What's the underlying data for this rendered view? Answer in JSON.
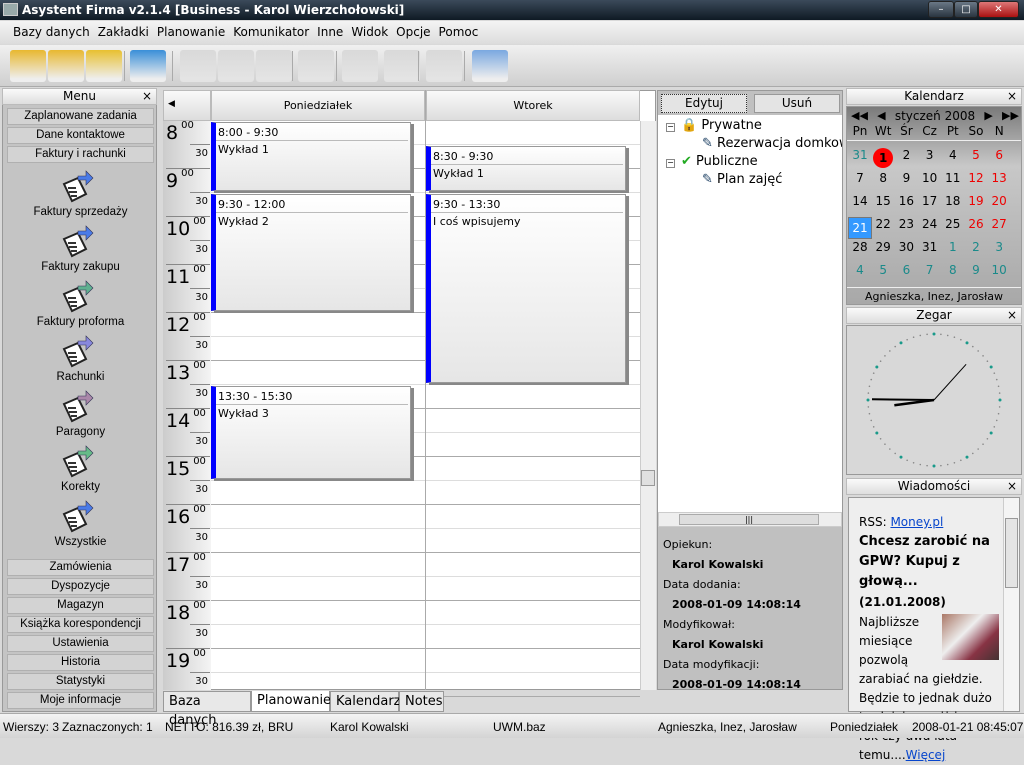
{
  "window": {
    "title": "Asystent Firma v2.1.4  [Business - Karol Wierzchołowski]",
    "minimize": "–",
    "maximize": "□",
    "close": "✕"
  },
  "menubar": [
    "Bazy danych",
    "Zakładki",
    "Planowanie",
    "Komunikator",
    "Inne",
    "Widok",
    "Opcje",
    "Pomoc"
  ],
  "toolbar": [
    "open-db-icon",
    "db-icon",
    "close-db-icon",
    "print-icon",
    "add-icon",
    "edit-icon",
    "remove-icon",
    "check-icon",
    "export-icon",
    "import-icon",
    "mail-icon",
    "calculator-icon"
  ],
  "sidebar": {
    "title": "Menu",
    "close": "×",
    "top_items": [
      "Zaplanowane zadania",
      "Dane kontaktowe",
      "Faktury i rachunki"
    ],
    "icons": [
      {
        "label": "Faktury sprzedaży",
        "color": "#4a7be8"
      },
      {
        "label": "Faktury zakupu",
        "color": "#4a7be8"
      },
      {
        "label": "Faktury proforma",
        "color": "#5fb090"
      },
      {
        "label": "Rachunki",
        "color": "#8888dd"
      },
      {
        "label": "Paragony",
        "color": "#aa88aa"
      },
      {
        "label": "Korekty",
        "color": "#66bb88"
      },
      {
        "label": "Wszystkie",
        "color": "#4a7be8"
      }
    ],
    "bottom_items": [
      "Zamówienia",
      "Dyspozycje",
      "Magazyn",
      "Książka korespondencji",
      "Ustawienia",
      "Historia",
      "Statystyki",
      "Moje informacje"
    ]
  },
  "planner": {
    "days": [
      "Poniedziałek",
      "Wtorek"
    ],
    "hours": [
      "8",
      "9",
      "10",
      "11",
      "12",
      "13",
      "14",
      "15",
      "16",
      "17",
      "18",
      "19"
    ],
    "min00": "00",
    "min30": "30",
    "events": [
      {
        "day": 0,
        "start": 8,
        "end": 9.5,
        "time": "8:00 - 9:30",
        "subject": "Wykład 1"
      },
      {
        "day": 0,
        "start": 9.5,
        "end": 12,
        "time": "9:30 - 12:00",
        "subject": "Wykład 2"
      },
      {
        "day": 0,
        "start": 13.5,
        "end": 15.5,
        "time": "13:30 - 15:30",
        "subject": "Wykład 3"
      },
      {
        "day": 1,
        "start": 8.5,
        "end": 9.5,
        "time": "8:30 - 9:30",
        "subject": "Wykład 1"
      },
      {
        "day": 1,
        "start": 9.5,
        "end": 13.5,
        "time": "9:30 - 13:30",
        "subject": "I coś wpisujemy"
      }
    ],
    "accent": "#0000ff"
  },
  "tabs": [
    {
      "label": "Baza danych",
      "active": false
    },
    {
      "label": "Planowanie",
      "active": true
    },
    {
      "label": "Kalendarz",
      "active": false
    },
    {
      "label": "Notes",
      "active": false
    }
  ],
  "tree": {
    "edit": "Edytuj",
    "delete": "Usuń",
    "groups": [
      {
        "label": "Prywatne",
        "icon": "lock-icon",
        "children": [
          "Rezerwacja domkow"
        ]
      },
      {
        "label": "Publiczne",
        "icon": "public-check-icon",
        "children": [
          "Plan zajęć"
        ]
      }
    ]
  },
  "details": {
    "owner_label": "Opiekun:",
    "owner": "Karol Kowalski",
    "added_label": "Data dodania:",
    "added": "2008-01-09 14:08:14",
    "modby_label": "Modyfikował:",
    "modby": "Karol Kowalski",
    "mod_label": "Data modyfikacji:",
    "mod": "2008-01-09 14:08:14"
  },
  "calendar": {
    "title": "Kalendarz",
    "close": "×",
    "month": "styczeń 2008",
    "weekdays": [
      "Pn",
      "Wt",
      "Śr",
      "Cz",
      "Pt",
      "So",
      "N"
    ],
    "weeks": [
      [
        "31",
        "1",
        "2",
        "3",
        "4",
        "5",
        "6"
      ],
      [
        "7",
        "8",
        "9",
        "10",
        "11",
        "12",
        "13"
      ],
      [
        "14",
        "15",
        "16",
        "17",
        "18",
        "19",
        "20"
      ],
      [
        "21",
        "22",
        "23",
        "24",
        "25",
        "26",
        "27"
      ],
      [
        "28",
        "29",
        "30",
        "31",
        "1",
        "2",
        "3"
      ],
      [
        "4",
        "5",
        "6",
        "7",
        "8",
        "9",
        "10"
      ]
    ],
    "today": "21",
    "holiday": "1",
    "namedays": "Agnieszka, Inez, Jarosław"
  },
  "clock": {
    "title": "Zegar",
    "close": "×",
    "time": "08:45:07"
  },
  "news": {
    "title": "Wiadomości",
    "close": "×",
    "rss_label": "RSS:",
    "source": "Money.pl",
    "headline": "Chcesz zarobić na GPW? Kupuj z głową...",
    "date": "(21.01.2008)",
    "body": "Najbliższe miesiące pozwolą zarabiać na giełdzie. Będzie to jednak dużo trudniejsze, niż jeszcze rok czy dwa lata temu....",
    "more": "Więcej"
  },
  "status": {
    "rows": "Wierszy: 3",
    "selected": "Zaznaczonych: 1",
    "netto": "NETTO: 816.39 zł,",
    "brutto": "BRU",
    "user": "Karol Kowalski",
    "db": "UWM.baz",
    "names": "Agnieszka, Inez, Jarosław",
    "day": "Poniedziałek",
    "datetime": "2008-01-21 08:45:07"
  }
}
